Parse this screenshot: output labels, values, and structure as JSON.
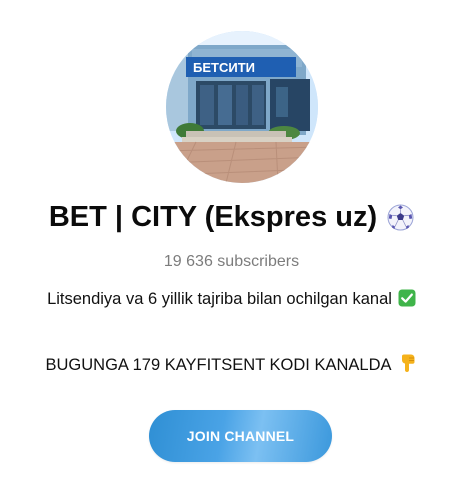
{
  "channel": {
    "title": "BET | CITY (Ekspres uz)",
    "title_emoji_icon": "soccer-ball-icon",
    "subscribers": "19 636 subscribers",
    "description_line_1": "Litsendiya va 6 yillik tajriba bilan ochilgan kanal",
    "description_line_1_emoji_icon": "check-mark-button-icon",
    "description_line_2": "BUGUNGA 179 KAYFITSENT KODI KANALDA",
    "description_line_2_emoji_icon": "pointing-down-hand-icon",
    "avatar_sign_text": "БЕТСИТИ"
  },
  "actions": {
    "join_label": "JOIN CHANNEL"
  },
  "colors": {
    "button_blue": "#3b98dc",
    "subscribers_gray": "#7c7c7c",
    "check_green": "#3fb44a",
    "hand_yellow": "#f5b21b"
  }
}
